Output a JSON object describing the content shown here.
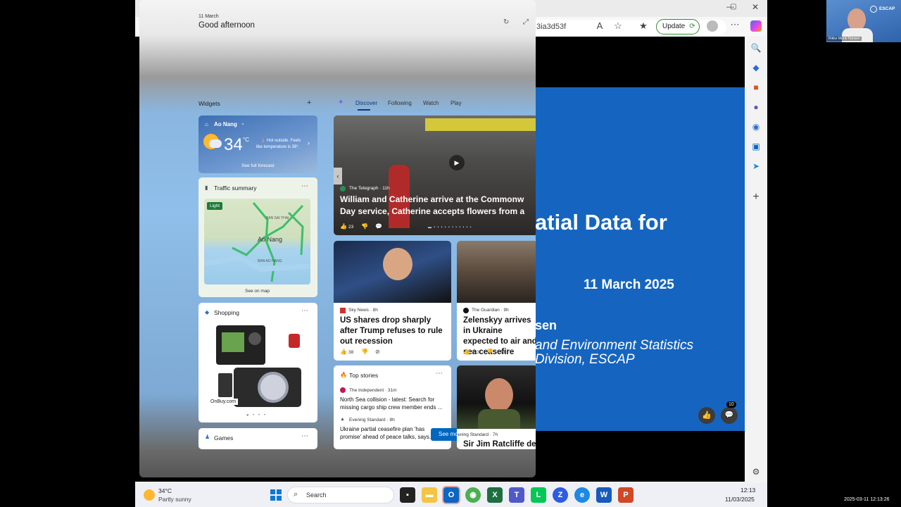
{
  "browser": {
    "url_fragment": "3ia3d53f",
    "update_label": "Update"
  },
  "slide": {
    "title_fragment": "atial Data for",
    "date": "11 March 2025",
    "presenter_fragment": "sen",
    "line1": "and Environment Statistics",
    "line2": "Division, ESCAP",
    "comment_count": "10"
  },
  "video": {
    "name": "Rikke Munk Hansen",
    "logo": "ESCAP"
  },
  "widgets": {
    "date": "11 March",
    "greeting": "Good afternoon",
    "section_label": "Widgets",
    "add_icon": "+",
    "tabs": [
      "Discover",
      "Following",
      "Watch",
      "Play"
    ],
    "weather": {
      "location": "Ao Nang",
      "temp": "34",
      "unit": "°C",
      "note_line1": "Hot outside. Feels",
      "note_line2": "like temperature is 39°.",
      "link": "See full forecast"
    },
    "traffic": {
      "title": "Traffic summary",
      "badge": "Light",
      "place": "Ao Nang",
      "label_top": "BAN SAI THAI",
      "label_bottom": "BAN AO NANG",
      "link": "See on map"
    },
    "shopping": {
      "title": "Shopping",
      "seller": "OnBuy.com"
    },
    "games": {
      "title": "Games"
    },
    "hero": {
      "source": "The Telegraph · 11h",
      "title_line1": "William and Catherine arrive at the Commonw",
      "title_line2": "Day service, Catherine accepts flowers from a",
      "likes": "23"
    },
    "news1": {
      "source": "Sky News · 8h",
      "title": "US shares drop sharply after Trump refuses to rule out recession",
      "likes": "38"
    },
    "news2": {
      "source": "The Guardian · 9h",
      "title": "Zelenskyy arrives in Ukraine expected to air and sea ceasefire",
      "likes": "123"
    },
    "top_stories": {
      "title": "Top stories",
      "items": [
        {
          "source": "The Independent · 31m",
          "text": "North Sea collision - latest: Search for missing cargo ship crew member ends ..."
        },
        {
          "source": "Evening Standard · 8h",
          "text": "Ukraine partial ceasefire plan 'has promise' ahead of peace talks, says..."
        }
      ],
      "see_more": "See more"
    },
    "news3": {
      "source": "ening Standard · 7h",
      "title": "Sir Jim Ratcliffe deli"
    }
  },
  "taskbar": {
    "weather_temp": "34°C",
    "weather_desc": "Partly sunny",
    "search_label": "Search",
    "time": "12:13",
    "date": "11/03/2025"
  },
  "overlay_timestamp": "2025-03-11 12:13:26",
  "colors": {
    "slide_bg": "#1565c0",
    "update_border": "#2f8c2f",
    "accent": "#0067c0"
  }
}
